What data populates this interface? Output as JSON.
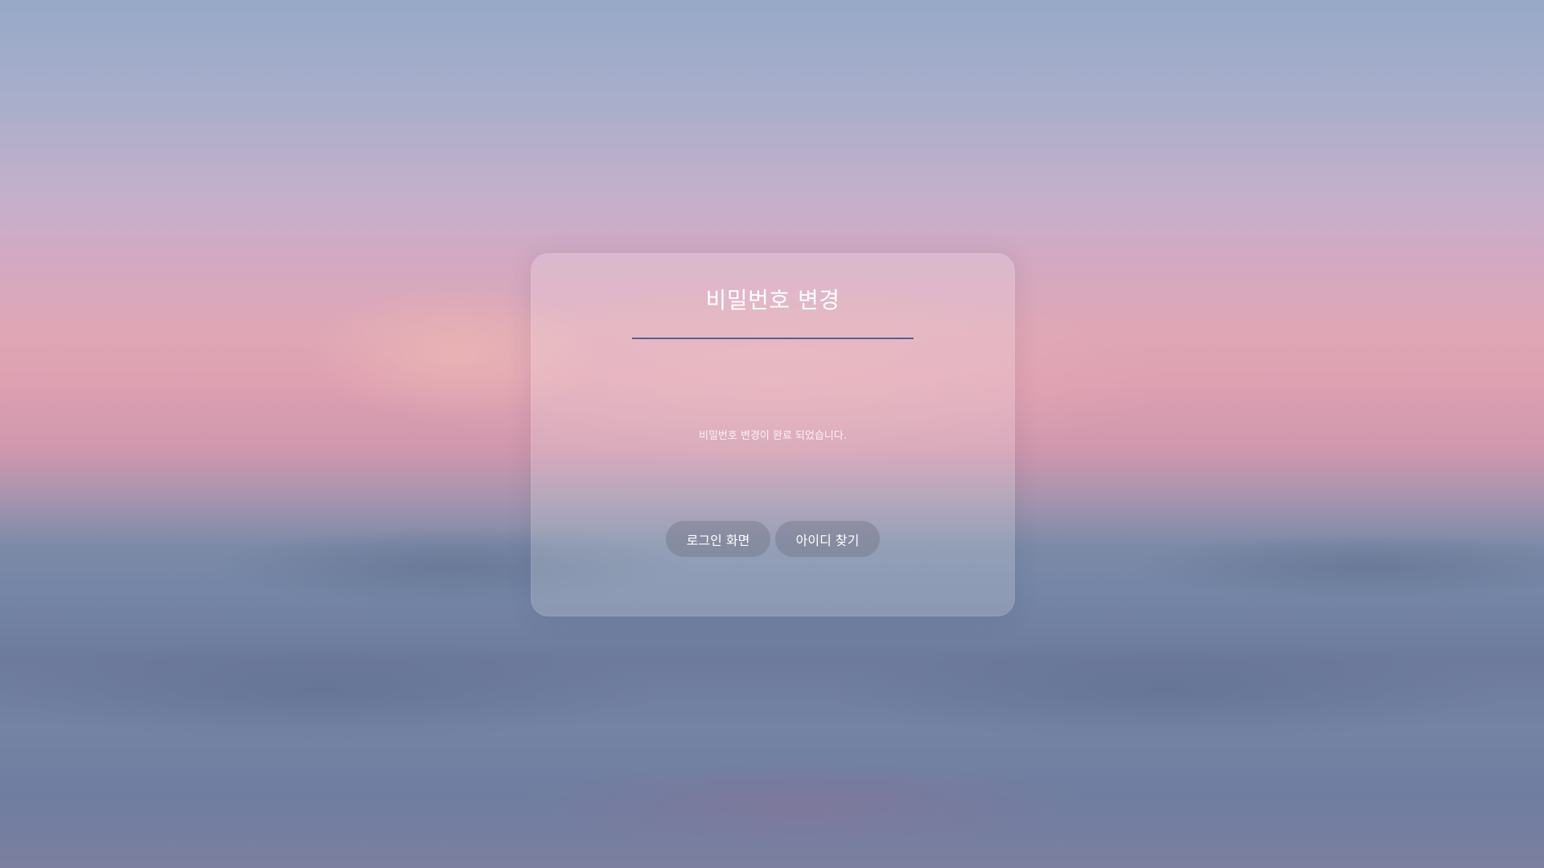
{
  "card": {
    "title": "비밀번호 변경",
    "message": "비밀번호 변경이 완료 되었습니다."
  },
  "buttons": {
    "login_label": "로그인 화면",
    "find_id_label": "아이디 찾기"
  },
  "colors": {
    "underline": "#52628c",
    "text": "#ffffff",
    "button_bg": "rgba(100,100,115,0.32)"
  }
}
